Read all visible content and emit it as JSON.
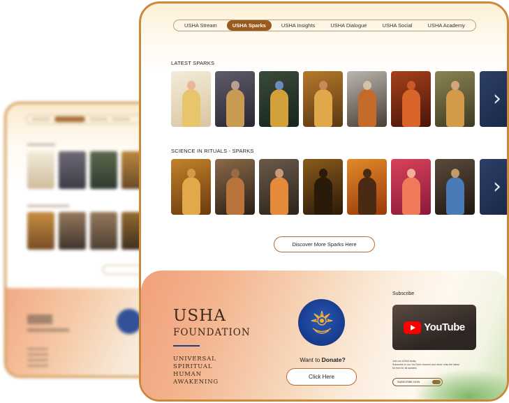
{
  "tabs": [
    {
      "label": "USHA Stream"
    },
    {
      "label": "USHA Sparks",
      "active": true
    },
    {
      "label": "USHA Insights"
    },
    {
      "label": "USHA Dialogue"
    },
    {
      "label": "USHA Social"
    },
    {
      "label": "USHA Academy"
    }
  ],
  "sections": {
    "latest": {
      "title": "LATEST SPARKS",
      "thumbs": [
        {
          "icon": "krishna-vishwaroop-art",
          "bg": [
            "#f3ecd9",
            "#d9c6a0"
          ],
          "fig": "#e8c46a",
          "head": "#e8b896"
        },
        {
          "icon": "rama-art",
          "bg": [
            "#5f5b6a",
            "#2a2633"
          ],
          "fig": "#c89b52",
          "head": "#b8a090"
        },
        {
          "icon": "krishna-art",
          "bg": [
            "#3a4a3a",
            "#17251c"
          ],
          "fig": "#d3a03a",
          "head": "#6d8bb8"
        },
        {
          "icon": "rama-bow-art",
          "bg": [
            "#b57a2a",
            "#5a3712"
          ],
          "fig": "#e0a84a",
          "head": "#c98a5a"
        },
        {
          "icon": "sages-art",
          "bg": [
            "#b9b5ae",
            "#4a3e34"
          ],
          "fig": "#c46a2a",
          "head": "#d6c0a8"
        },
        {
          "icon": "ganesha-art",
          "bg": [
            "#a4421a",
            "#4a140a"
          ],
          "fig": "#d8642a",
          "head": "#c85a2a"
        },
        {
          "icon": "shiva-art",
          "bg": [
            "#8a8452",
            "#3f3b22"
          ],
          "fig": "#d39a4a",
          "head": "#d2a67a"
        }
      ]
    },
    "rituals": {
      "title": "SCIENCE IN RITUALS - SPARKS",
      "thumbs": [
        {
          "icon": "narasimha-art",
          "bg": [
            "#c2822a",
            "#6a3a10"
          ],
          "fig": "#e2a84a",
          "head": "#d49a4a"
        },
        {
          "icon": "hanuman-art",
          "bg": [
            "#8a6a4a",
            "#2a1f16"
          ],
          "fig": "#b8743a",
          "head": "#9a6a42"
        },
        {
          "icon": "monk-reading-art",
          "bg": [
            "#6a5a4a",
            "#2c231c"
          ],
          "fig": "#e48a3a",
          "head": "#c99878"
        },
        {
          "icon": "krishna-silhouette-art",
          "bg": [
            "#8a5a1a",
            "#2a1a08"
          ],
          "fig": "#2a1a0a",
          "head": "#2a1a0a"
        },
        {
          "icon": "warrior-silhouette-art",
          "bg": [
            "#e28a2a",
            "#9a3a0a"
          ],
          "fig": "#4a2a12",
          "head": "#4a2a12"
        },
        {
          "icon": "meditation-art",
          "bg": [
            "#d8425a",
            "#8a1a3a"
          ],
          "fig": "#f07a5a",
          "head": "#f2b09a"
        },
        {
          "icon": "deities-group-art",
          "bg": [
            "#5a4a3a",
            "#201812"
          ],
          "fig": "#4a7ab8",
          "head": "#c49a6a"
        }
      ]
    }
  },
  "discover_label": "Discover More Sparks Here",
  "footer": {
    "title": "USHA",
    "subtitle": "FOUNDATION",
    "tagline": [
      "UNIVERSAL",
      "SPIRITUAL",
      "HUMAN",
      "AWAKENING"
    ],
    "donate_prefix": "Want to ",
    "donate_bold": "Donate?",
    "click_label": "Click Here",
    "subscribe_label": "Subscribe",
    "youtube_word": "YouTube",
    "yt_line1": "Join our USHA family",
    "yt_line2": "Subscribe to our YouTube channel and never miss the latest",
    "yt_line3": "for free for all updates",
    "sub_button": "SUBSCRIBE NOW"
  },
  "colors": {
    "accent": "#9b5a1d",
    "border": "#c98a3a",
    "logo_blue": "#183f91"
  }
}
